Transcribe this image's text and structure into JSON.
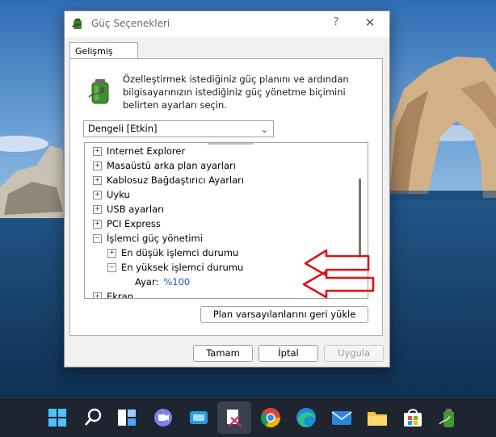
{
  "window": {
    "title": "Güç Seçenekleri",
    "help_label": "?",
    "close_label": "✕"
  },
  "tab": {
    "label": "Gelişmiş ayarlar"
  },
  "description": "Özelleştirmek istediğiniz güç planını ve ardından bilgisayarınızın istediğiniz güç yönetme biçimini belirten ayarları seçin.",
  "plan_select": {
    "value": "Dengeli [Etkin]",
    "chevron": "⌄"
  },
  "tree": {
    "items": [
      {
        "label": "Internet Explorer",
        "expander": "+"
      },
      {
        "label": "Masaüstü arka plan ayarları",
        "expander": "+"
      },
      {
        "label": "Kablosuz Bağdaştırıcı Ayarları",
        "expander": "+"
      },
      {
        "label": "Uyku",
        "expander": "+"
      },
      {
        "label": "USB ayarları",
        "expander": "+"
      },
      {
        "label": "PCI Express",
        "expander": "+"
      },
      {
        "label": "İşlemci güç yönetimi",
        "expander": "−"
      },
      {
        "label": "En düşük işlemci durumu",
        "expander": "+"
      },
      {
        "label": "En yüksek işlemci durumu",
        "expander": "−"
      },
      {
        "label": "Ekran",
        "expander": "+"
      }
    ],
    "setting": {
      "label": "Ayar:",
      "value": "%100"
    }
  },
  "buttons": {
    "restore": "Plan varsayılanlarını geri yükle",
    "ok": "Tamam",
    "cancel": "İptal",
    "apply": "Uygula"
  },
  "taskbar": {
    "icons": [
      "windows-start-icon",
      "search-icon",
      "task-view-icon",
      "teams-chat-icon",
      "widgets-icon",
      "snipping-tool-icon",
      "chrome-icon",
      "edge-icon",
      "mail-icon",
      "file-explorer-icon",
      "microsoft-store-icon",
      "power-options-battery-icon"
    ]
  },
  "colors": {
    "taskbar_bg": "#1f2530",
    "link_blue": "#1a56c8",
    "annotation_red": "#e01010",
    "sky": "#4d86c4",
    "sea": "#1e4d7a"
  }
}
